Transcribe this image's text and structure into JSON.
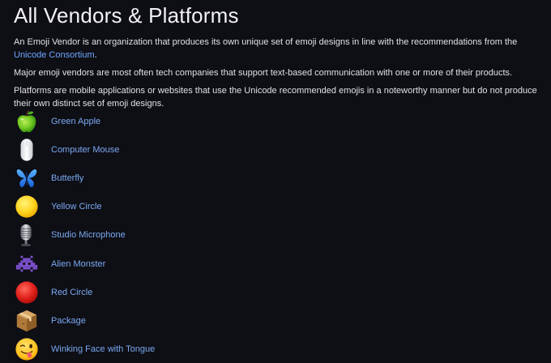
{
  "page": {
    "title": "All Vendors & Platforms",
    "intro_1_text": "An Emoji Vendor is an organization that produces its own unique set of emoji designs in line with the recommendations from the ",
    "intro_1_link": "Unicode Consortium",
    "intro_1_end": ".",
    "intro_2": "Major emoji vendors are most often tech companies that support text-based communication with one or more of their products.",
    "intro_3": "Platforms are mobile applications or websites that use the Unicode recommended emojis in a noteworthy manner but do not produce their own distinct set of emoji designs."
  },
  "emojis": [
    {
      "label": "Green Apple",
      "icon": "green-apple-icon"
    },
    {
      "label": "Computer Mouse",
      "icon": "computer-mouse-icon"
    },
    {
      "label": "Butterfly",
      "icon": "butterfly-icon"
    },
    {
      "label": "Yellow Circle",
      "icon": "yellow-circle-icon"
    },
    {
      "label": "Studio Microphone",
      "icon": "studio-microphone-icon"
    },
    {
      "label": "Alien Monster",
      "icon": "alien-monster-icon"
    },
    {
      "label": "Red Circle",
      "icon": "red-circle-icon"
    },
    {
      "label": "Package",
      "icon": "package-icon"
    },
    {
      "label": "Winking Face with Tongue",
      "icon": "winking-face-with-tongue-icon"
    }
  ],
  "colors": {
    "background": "#0e0e15",
    "link": "#6ea8ff",
    "text": "#e0e0e6"
  }
}
